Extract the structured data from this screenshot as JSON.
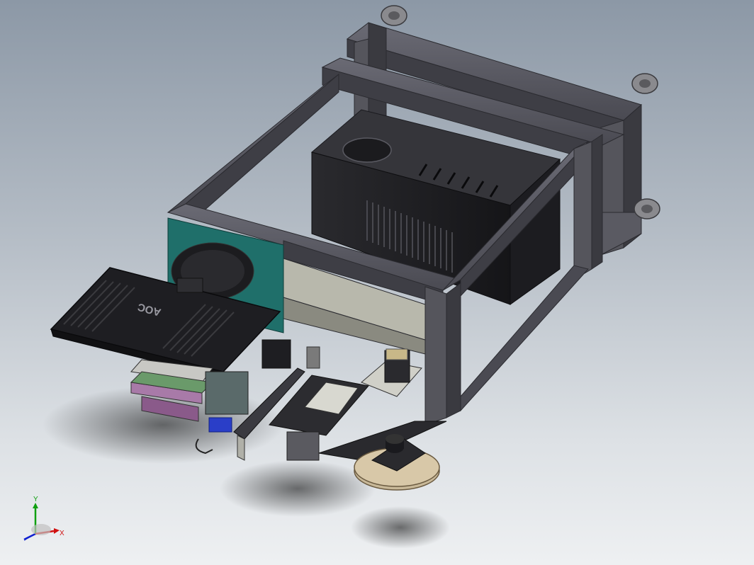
{
  "window": {
    "title": ""
  },
  "monitor": {
    "brand_text": "AOC"
  },
  "triad": {
    "x_label": "X",
    "y_label": "Y"
  },
  "colors": {
    "background_top": "#8c98a6",
    "background_bottom": "#eef0f2",
    "frame": "#4a4a52",
    "accent_panel": "#1f6f6a",
    "axis_x": "#d01010",
    "axis_y": "#10a010",
    "axis_z": "#1020d0"
  }
}
